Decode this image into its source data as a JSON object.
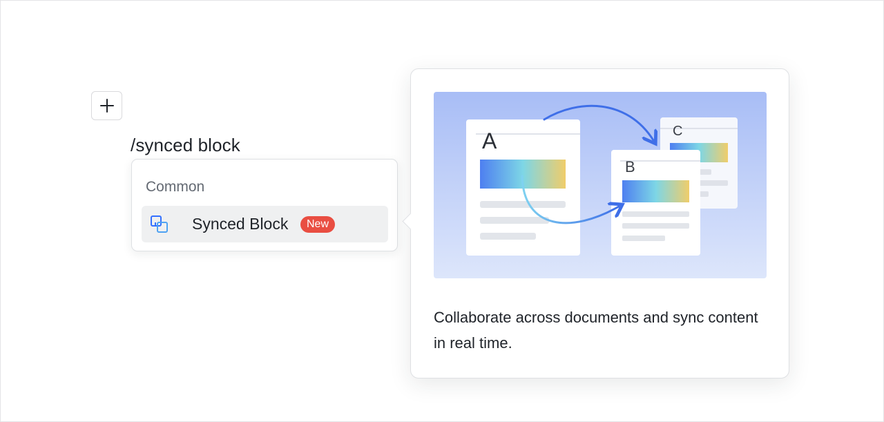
{
  "editor": {
    "plus_icon": "plus-icon",
    "command_text": "/synced block"
  },
  "menu": {
    "section_label": "Common",
    "items": [
      {
        "label": "Synced Block",
        "icon": "synced-block-icon",
        "badge": "New"
      }
    ]
  },
  "preview": {
    "illustration": {
      "doc_labels": [
        "A",
        "B",
        "C"
      ]
    },
    "description": "Collaborate across documents and sync content in real time."
  },
  "colors": {
    "badge": "#e94e42",
    "accent_blue": "#3370ff",
    "menu_item_hover": "#eff0f1",
    "text_primary": "#1f2329",
    "text_secondary": "#646a73"
  }
}
